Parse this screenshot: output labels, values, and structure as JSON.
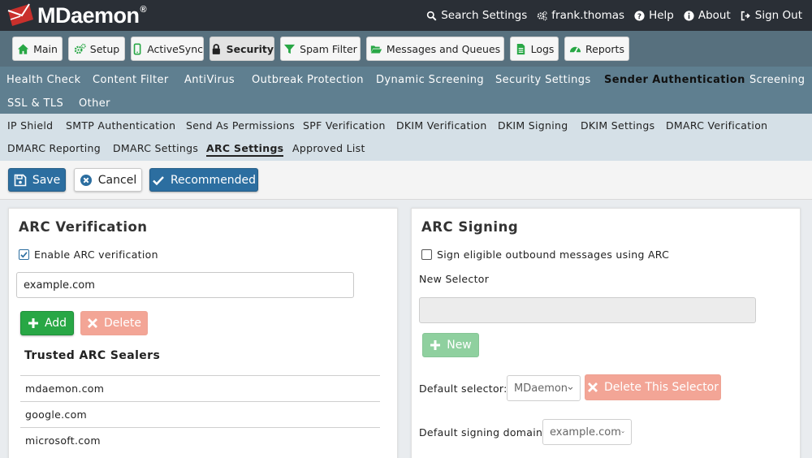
{
  "app": {
    "logo_text": "MDaemon",
    "logo_mark": "®"
  },
  "topbar": {
    "links": [
      {
        "label": "Search Settings",
        "icon": "search-icon"
      },
      {
        "label": "frank.thomas",
        "icon": "user-gears-icon"
      },
      {
        "label": "Help",
        "icon": "question-circle-icon"
      },
      {
        "label": "About",
        "icon": "info-circle-icon"
      },
      {
        "label": "Sign Out",
        "icon": "sign-out-icon"
      }
    ]
  },
  "main_nav": [
    {
      "label": "Main",
      "icon": "home-icon"
    },
    {
      "label": "Setup",
      "icon": "gears-icon"
    },
    {
      "label": "ActiveSync",
      "icon": "mobile-icon"
    },
    {
      "label": "Security",
      "icon": "lock-icon",
      "active": true
    },
    {
      "label": "Spam Filter",
      "icon": "filter-icon"
    },
    {
      "label": "Messages and Queues",
      "icon": "folder-open-icon"
    },
    {
      "label": "Logs",
      "icon": "file-text-icon"
    },
    {
      "label": "Reports",
      "icon": "dashboard-icon"
    }
  ],
  "security_nav": [
    {
      "label": "Health Check"
    },
    {
      "label": "Content Filter"
    },
    {
      "label": "AntiVirus"
    },
    {
      "label": "Outbreak Protection"
    },
    {
      "label": "Dynamic Screening"
    },
    {
      "label": "Security Settings"
    },
    {
      "label": "Sender Authentication",
      "active": true
    },
    {
      "label": "Screening"
    },
    {
      "label": "SSL & TLS"
    },
    {
      "label": "Other"
    }
  ],
  "auth_nav": [
    {
      "label": "IP Shield"
    },
    {
      "label": "SMTP Authentication"
    },
    {
      "label": "Send As Permissions"
    },
    {
      "label": "SPF Verification"
    },
    {
      "label": "DKIM Verification"
    },
    {
      "label": "DKIM Signing"
    },
    {
      "label": "DKIM Settings"
    },
    {
      "label": "DMARC Verification"
    },
    {
      "label": "DMARC Reporting"
    },
    {
      "label": "DMARC Settings"
    },
    {
      "label": "ARC Settings",
      "active": true
    },
    {
      "label": "Approved List"
    }
  ],
  "toolbar": {
    "save_label": "Save",
    "cancel_label": "Cancel",
    "recommended_label": "Recommended"
  },
  "arc_verification": {
    "title": "ARC Verification",
    "enable_label": "Enable ARC verification",
    "enable_checked": true,
    "domain_value": "example.com",
    "add_label": "Add",
    "delete_label": "Delete",
    "sealers_title": "Trusted ARC Sealers",
    "sealers": [
      "mdaemon.com",
      "google.com",
      "microsoft.com"
    ]
  },
  "arc_signing": {
    "title": "ARC Signing",
    "sign_label": "Sign eligible outbound messages using ARC",
    "sign_checked": false,
    "new_selector_label": "New Selector",
    "new_selector_value": "",
    "new_label": "New",
    "default_selector_label": "Default selector:",
    "default_selector_value": "MDaemon",
    "delete_selector_label": "Delete This Selector",
    "signing_domain_label": "Default signing domain:",
    "signing_domain_value": "example.com"
  },
  "colors": {
    "topbar": "#2a2f36",
    "main_nav_bg": "#57707e",
    "security_nav_bg": "#5f7f90",
    "auth_nav_bg": "#d5e0e7",
    "primary_blue": "#2c6ea0",
    "success_green": "#28a745",
    "danger_faded": "#f3a596",
    "logo_red": "#c9302c"
  }
}
